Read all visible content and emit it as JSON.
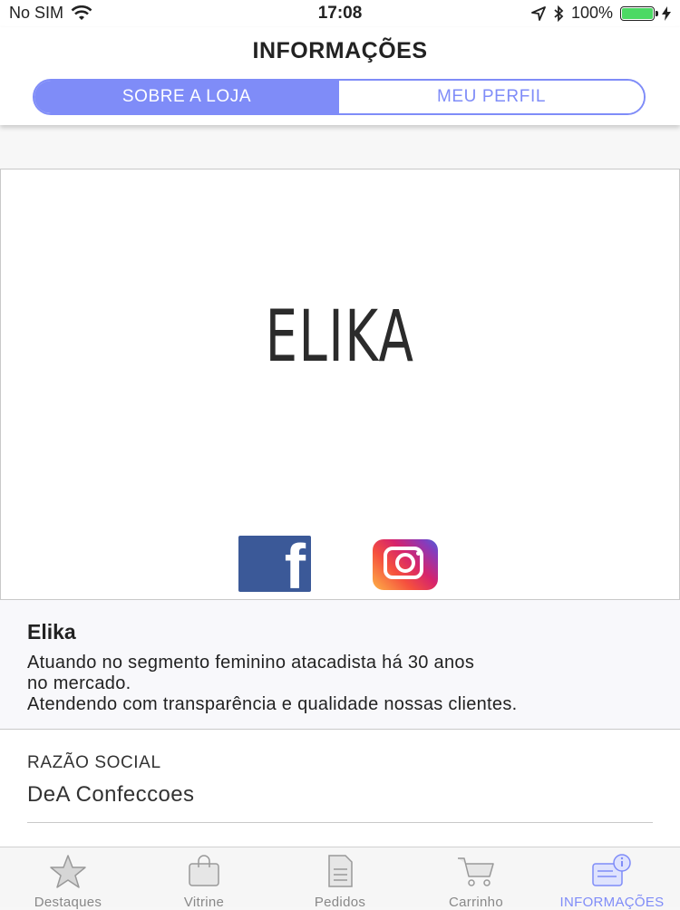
{
  "status_bar": {
    "carrier": "No SIM",
    "time": "17:08",
    "battery": "100%",
    "battery_level": 1.0
  },
  "header": {
    "title": "INFORMAÇÕES",
    "tabs": [
      {
        "label": "SOBRE A LOJA",
        "active": true
      },
      {
        "label": "MEU PERFIL",
        "active": false
      }
    ]
  },
  "store_card": {
    "logo_text": "ELIKA",
    "social": [
      "facebook-icon",
      "instagram-icon"
    ]
  },
  "store_info": {
    "name": "Elika",
    "description": "Atuando no segmento feminino atacadista há 30 anos\nno mercado.\nAtendendo com transparência e qualidade nossas clientes."
  },
  "details": {
    "label": "RAZÃO SOCIAL",
    "value": "DeA Confeccoes"
  },
  "tab_bar": {
    "items": [
      {
        "label": "Destaques",
        "icon": "star-icon"
      },
      {
        "label": "Vitrine",
        "icon": "shopping-bag-icon"
      },
      {
        "label": "Pedidos",
        "icon": "document-list-icon"
      },
      {
        "label": "Carrinho",
        "icon": "cart-icon"
      },
      {
        "label": "INFORMAÇÕES",
        "icon": "info-icon",
        "active": true
      }
    ]
  },
  "colors": {
    "accent": "#7f8cf8",
    "facebook": "#3b5998",
    "battery": "#4cd964"
  }
}
